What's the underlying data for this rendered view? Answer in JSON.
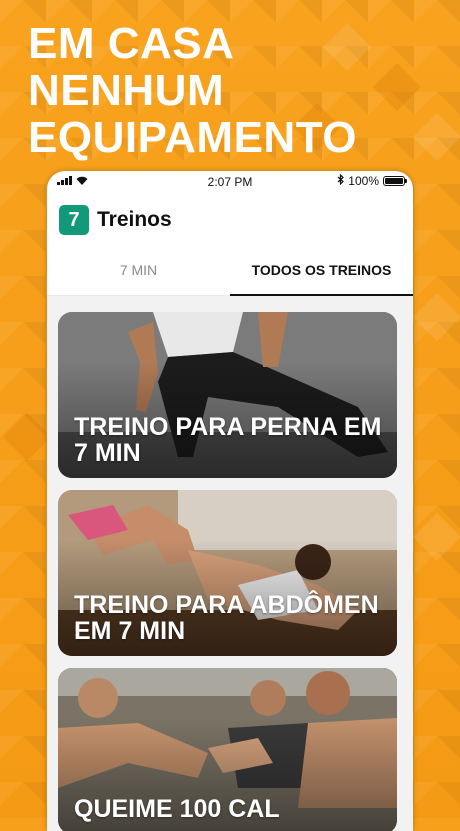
{
  "headline": [
    "EM CASA",
    "NENHUM",
    "EQUIPAMENTO"
  ],
  "status_bar": {
    "time": "2:07 PM",
    "battery": "100%"
  },
  "app": {
    "logo": "7",
    "title": "Treinos"
  },
  "tabs": [
    {
      "label": "7 MIN",
      "active": false
    },
    {
      "label": "TODOS OS TREINOS",
      "active": true
    }
  ],
  "workouts": [
    {
      "title": "TREINO PARA PERNA EM 7 MIN"
    },
    {
      "title": "TREINO PARA ABDÔMEN EM 7 MIN"
    },
    {
      "title": "QUEIME 100 CAL"
    }
  ],
  "colors": {
    "background": "#f7a01c",
    "logo": "#11997a"
  },
  "icons": [
    "signal-icon",
    "wifi-icon",
    "bluetooth-icon",
    "battery-icon"
  ]
}
